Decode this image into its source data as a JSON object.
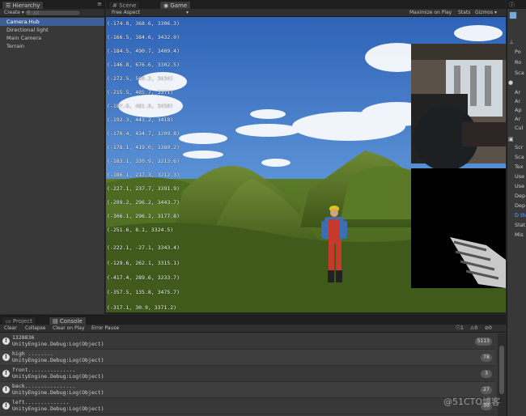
{
  "hierarchy": {
    "tab_label": "Hierarchy",
    "create_label": "Create ▾",
    "search_placeholder": "All",
    "items": [
      "Camera.Hub",
      "Directional light",
      "Main Camera",
      "Terrain"
    ]
  },
  "game_panel": {
    "tabs": [
      "Scene",
      "Game"
    ],
    "aspect_label": "Free Aspect",
    "maximize_label": "Maximize on Play",
    "stats_label": "Stats",
    "gizmos_label": "Gizmos ▾",
    "coords": [
      "(-174.8, 368.6, 3306.3)",
      "(-166.5, 384.6, 3432.0)",
      "(-184.5, 490.7, 3409.4)",
      "(-146.8, 676.6, 3302.5)",
      "(-272.5, 569.2, 3434)",
      "(-215.5, 485.7, 3371)",
      "(-187.6, 481.6, 3450)",
      "(-192.3, 443.2, 3418)",
      "(-170.4, 434.7, 3209.8)",
      "(-178.1, 419.0, 3380.2)",
      "(-183.1, 320.9, 3213.6)",
      "(-186.1, 217.3, 3212.3)",
      "(-227.1, 237.7, 3391.9)",
      "(-209.2, 296.2, 3443.7)",
      "(-306.1, 296.2, 3177.8)",
      "(-251.6, 8.1, 3324.5)",
      "(-222.1, -27.1, 3343.4)",
      "(-129.6, 262.1, 3315.1)",
      "(-417.4, 289.6, 3233.7)",
      "(-357.5, 135.8, 3475.7)",
      "(-317.1, 30.9, 3371.2)"
    ]
  },
  "inspector": {
    "items": [
      "Po",
      "Ro",
      "Sca",
      "Ar",
      "Ar",
      "Ap",
      "Ar",
      "Cul",
      "Scr",
      "Sca",
      "Tex",
      "Use",
      "Use",
      "Dep",
      "Dep",
      "D th",
      "Stat",
      "Mis"
    ]
  },
  "console": {
    "tabs": [
      "Project",
      "Console"
    ],
    "buttons": [
      "Clear",
      "Collapse",
      "Clear on Play",
      "Error Pause"
    ],
    "badges": [
      "1",
      "0",
      "0"
    ],
    "rows": [
      {
        "l1": "1328836",
        "l2": "UnityEngine.Debug:Log(Object)",
        "count": "5113"
      },
      {
        "l1": "high ........",
        "l2": "UnityEngine.Debug:Log(Object)",
        "count": "78"
      },
      {
        "l1": "front...............",
        "l2": "UnityEngine.Debug:Log(Object)",
        "count": "3"
      },
      {
        "l1": "back................",
        "l2": "UnityEngine.Debug:Log(Object)",
        "count": "27"
      },
      {
        "l1": "left..............",
        "l2": "UnityEngine.Debug:Log(Object)",
        "count": "30"
      }
    ]
  },
  "watermark": "@51CTO博客",
  "colors": {
    "selection": "#3e5f96",
    "panel": "#383838",
    "sky": "#3f78c4",
    "grass": "#4d6b22"
  }
}
